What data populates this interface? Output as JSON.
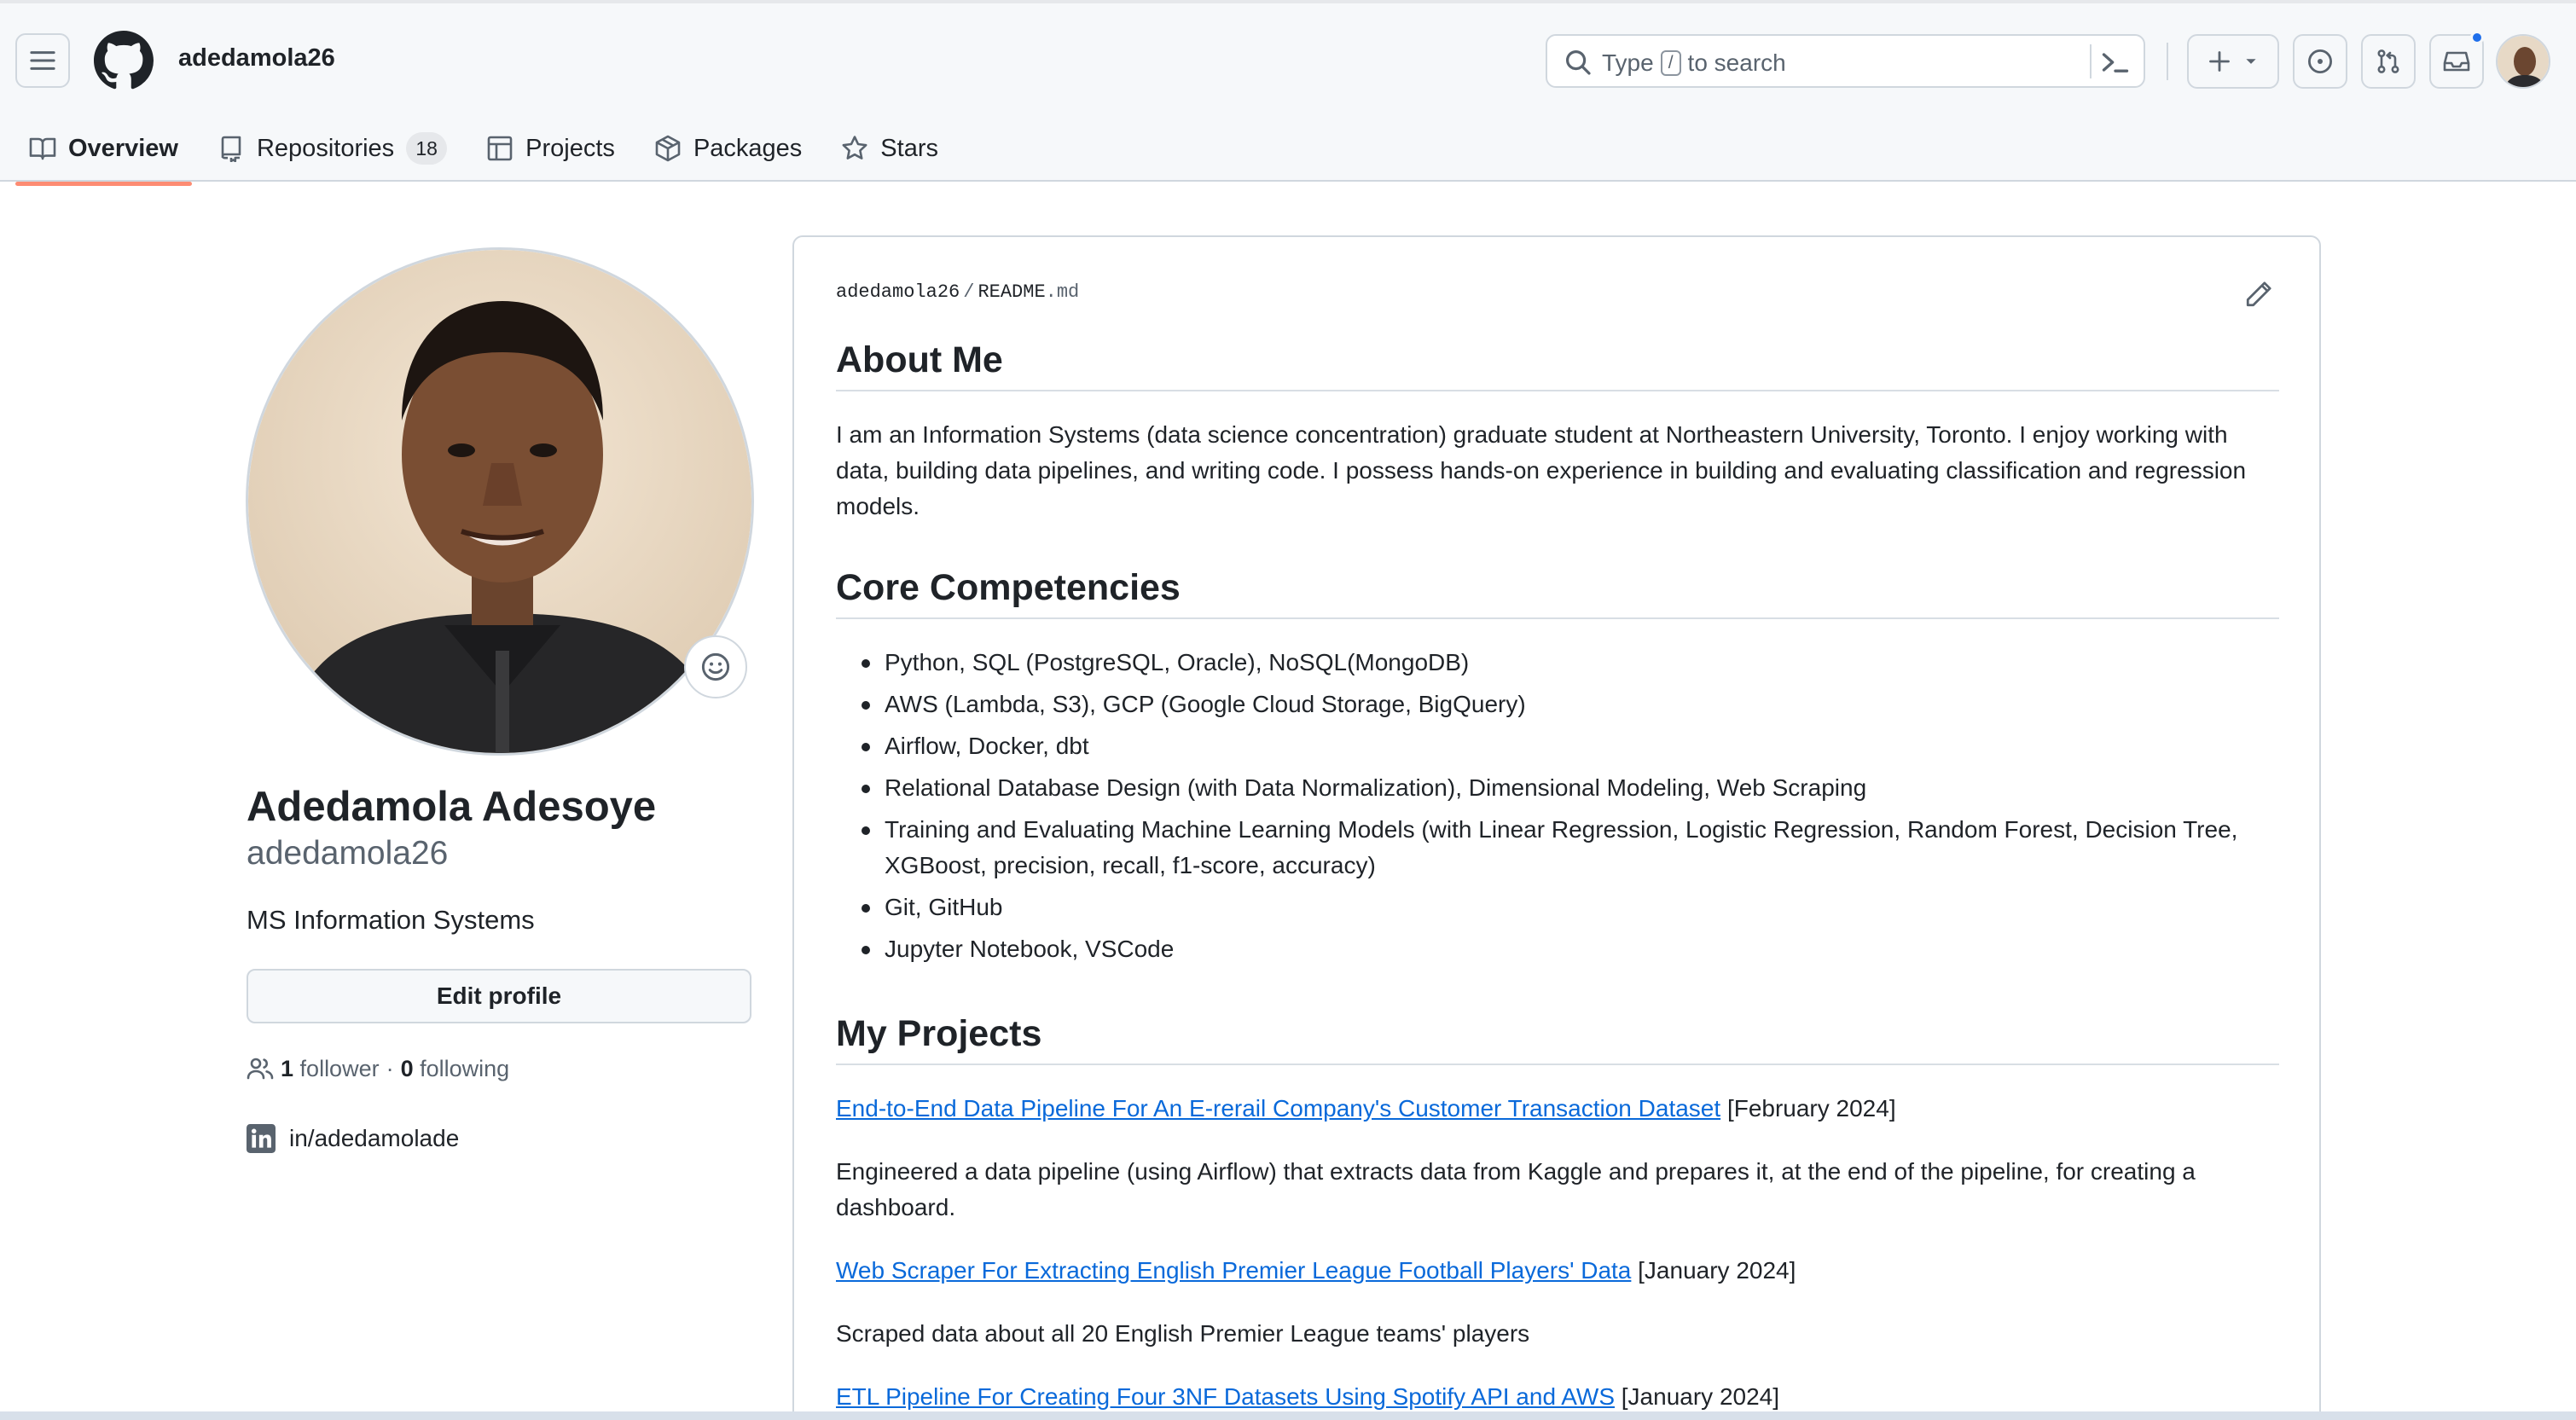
{
  "header": {
    "username": "adedamola26",
    "search_prefix": "Type",
    "search_key": "/",
    "search_suffix": "to search"
  },
  "tabs": [
    {
      "label": "Overview",
      "icon": "book-icon"
    },
    {
      "label": "Repositories",
      "icon": "repo-icon",
      "count": "18"
    },
    {
      "label": "Projects",
      "icon": "table-icon"
    },
    {
      "label": "Packages",
      "icon": "package-icon"
    },
    {
      "label": "Stars",
      "icon": "star-icon"
    }
  ],
  "profile": {
    "name": "Adedamola Adesoye",
    "login": "adedamola26",
    "bio": "MS Information Systems",
    "edit_label": "Edit profile",
    "followers_count": "1",
    "followers_label": "follower",
    "dot": "·",
    "following_count": "0",
    "following_label": "following",
    "linkedin": "in/adedamolade"
  },
  "readme": {
    "owner": "adedamola26",
    "sep": "/",
    "file_base": "README",
    "file_ext": ".md",
    "about_heading": "About Me",
    "about_text": "I am an Information Systems (data science concentration) graduate student at Northeastern University, Toronto. I enjoy working with data, building data pipelines, and writing code. I possess hands-on experience in building and evaluating classification and regression models.",
    "core_heading": "Core Competencies",
    "competencies": [
      "Python, SQL (PostgreSQL, Oracle), NoSQL(MongoDB)",
      "AWS (Lambda, S3), GCP (Google Cloud Storage, BigQuery)",
      "Airflow, Docker, dbt",
      "Relational Database Design (with Data Normalization), Dimensional Modeling, Web Scraping",
      "Training and Evaluating Machine Learning Models (with Linear Regression, Logistic Regression, Random Forest, Decision Tree, XGBoost, precision, recall, f1-score, accuracy)",
      "Git, GitHub",
      "Jupyter Notebook, VSCode"
    ],
    "projects_heading": "My Projects",
    "projects": [
      {
        "title": "End-to-End Data Pipeline For An E-rerail Company's Customer Transaction Dataset",
        "date": "[February 2024]",
        "desc": "Engineered a data pipeline (using Airflow) that extracts data from Kaggle and prepares it, at the end of the pipeline, for creating a dashboard."
      },
      {
        "title": "Web Scraper For Extracting English Premier League Football Players' Data",
        "date": "[January 2024]",
        "desc": "Scraped data about all 20 English Premier League teams' players"
      },
      {
        "title": "ETL Pipeline For Creating Four 3NF Datasets Using Spotify API and AWS",
        "date": "[January 2024]",
        "desc": ""
      }
    ]
  },
  "colors": {
    "accent_underline": "#fd8c73",
    "link": "#0969da",
    "notification": "#1f6feb"
  }
}
